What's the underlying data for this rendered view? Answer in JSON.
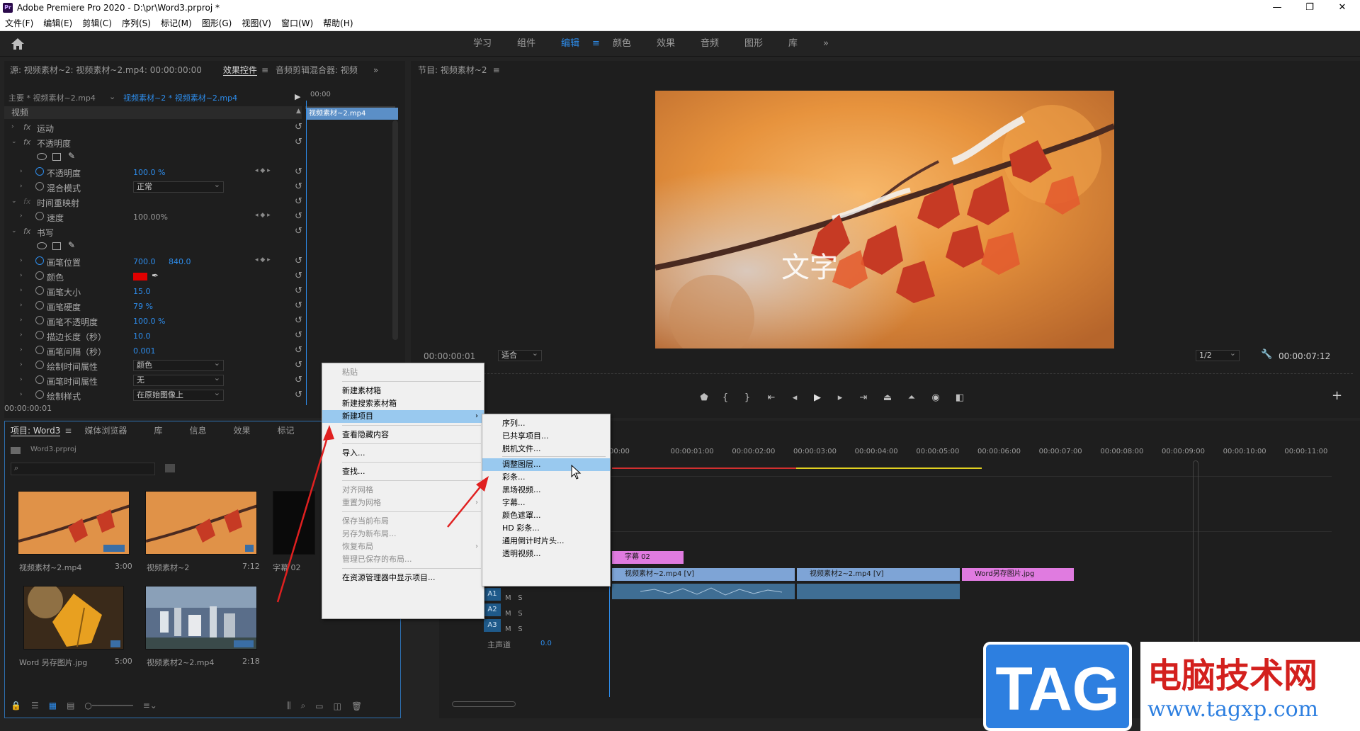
{
  "app": {
    "title": "Adobe Premiere Pro 2020 - D:\\pr\\Word3.prproj *",
    "badge": "Pr"
  },
  "window_controls": {
    "minimize": "—",
    "maximize": "❐",
    "close": "✕"
  },
  "menubar": [
    "文件(F)",
    "编辑(E)",
    "剪辑(C)",
    "序列(S)",
    "标记(M)",
    "图形(G)",
    "视图(V)",
    "窗口(W)",
    "帮助(H)"
  ],
  "workspaces": {
    "items": [
      "学习",
      "组件",
      "编辑",
      "颜色",
      "效果",
      "音频",
      "图形",
      "库"
    ],
    "active": "编辑",
    "more": "»"
  },
  "source_panel": {
    "tabs": [
      "源: 视频素材~2: 视频素材~2.mp4: 00:00:00:00",
      "效果控件",
      "音频剪辑混合器: 视频"
    ],
    "master": "主要 * 视频素材~2.mp4",
    "clip": "视频素材~2 * 视频素材~2.mp4",
    "time0": "00:00",
    "mini_clip": "视频素材~2.mp4",
    "section": "视频",
    "timecode": "00:00:00:01"
  },
  "effects": [
    {
      "type": "fx",
      "label": "运动"
    },
    {
      "type": "fx",
      "label": "不透明度",
      "open": true
    },
    {
      "type": "shapes"
    },
    {
      "type": "prop",
      "label": "不透明度",
      "value": "100.0 %",
      "kf": true
    },
    {
      "type": "select",
      "label": "混合模式",
      "value": "正常"
    },
    {
      "type": "fxg",
      "label": "时间重映射",
      "open": true
    },
    {
      "type": "prop",
      "label": "速度",
      "value": "100.00%",
      "kf": true,
      "gray": true
    },
    {
      "type": "fx",
      "label": "书写",
      "open": true
    },
    {
      "type": "shapes"
    },
    {
      "type": "prop",
      "label": "画笔位置",
      "value": "700.0",
      "value2": "840.0",
      "kf": true
    },
    {
      "type": "color",
      "label": "颜色"
    },
    {
      "type": "prop",
      "label": "画笔大小",
      "value": "15.0"
    },
    {
      "type": "prop",
      "label": "画笔硬度",
      "value": "79 %"
    },
    {
      "type": "prop",
      "label": "画笔不透明度",
      "value": "100.0 %"
    },
    {
      "type": "prop",
      "label": "描边长度（秒）",
      "value": "10.0"
    },
    {
      "type": "prop",
      "label": "画笔间隔（秒）",
      "value": "0.001"
    },
    {
      "type": "select",
      "label": "绘制时间属性",
      "value": "颜色"
    },
    {
      "type": "select",
      "label": "画笔时间属性",
      "value": "无"
    },
    {
      "type": "select",
      "label": "绘制样式",
      "value": "在原始图像上"
    }
  ],
  "program": {
    "title": "节目: 视频素材~2",
    "overlay_text": "文字",
    "timecode": "00:00:00:01",
    "fit": "适合",
    "resolution": "1/2",
    "duration": "00:00:07:12"
  },
  "project": {
    "tabs": [
      "项目: Word3",
      "媒体浏览器",
      "库",
      "信息",
      "效果",
      "标记"
    ],
    "file": "Word3.prproj",
    "items": [
      {
        "name": "视频素材~2.mp4",
        "dur": "3:00"
      },
      {
        "name": "视频素材~2",
        "dur": "7:12"
      },
      {
        "name": "字幕 02",
        "dur": ""
      },
      {
        "name": "Word 另存图片.jpg",
        "dur": "5:00"
      },
      {
        "name": "视频素材2~2.mp4",
        "dur": "2:18"
      }
    ]
  },
  "context_menu": {
    "items": [
      {
        "label": "粘贴",
        "dis": true
      },
      {
        "sep": true
      },
      {
        "label": "新建素材箱"
      },
      {
        "label": "新建搜索素材箱"
      },
      {
        "label": "新建项目",
        "hl": true,
        "sub": true
      },
      {
        "sep": true
      },
      {
        "label": "查看隐藏内容"
      },
      {
        "sep": true
      },
      {
        "label": "导入..."
      },
      {
        "sep": true
      },
      {
        "label": "查找..."
      },
      {
        "sep": true
      },
      {
        "label": "对齐网格",
        "dis": true
      },
      {
        "label": "重置为网格",
        "dis": true,
        "sub": true
      },
      {
        "sep": true
      },
      {
        "label": "保存当前布局",
        "dis": true
      },
      {
        "label": "另存为新布局...",
        "dis": true
      },
      {
        "label": "恢复布局",
        "dis": true,
        "sub": true
      },
      {
        "label": "管理已保存的布局...",
        "dis": true
      },
      {
        "sep": true
      },
      {
        "label": "在资源管理器中显示项目..."
      }
    ]
  },
  "submenu": {
    "items": [
      "序列...",
      "已共享项目...",
      "脱机文件...",
      "调整图层...",
      "彩条...",
      "黑场视频...",
      "字幕...",
      "颜色遮罩...",
      "HD 彩条...",
      "通用倒计时片头...",
      "透明视频..."
    ],
    "highlight": "调整图层..."
  },
  "timeline": {
    "ruler": [
      "00:00",
      "00:00:01:00",
      "00:00:02:00",
      "00:00:03:00",
      "00:00:04:00",
      "00:00:05:00",
      "00:00:06:00",
      "00:00:07:00",
      "00:00:08:00",
      "00:00:09:00",
      "00:00:10:00",
      "00:00:11:00"
    ],
    "clips": {
      "title": "字幕 02",
      "v1a": "视频素材~2.mp4 [V]",
      "v1b": "视频素材2~2.mp4 [V]",
      "v1c": "Word另存图片.jpg"
    },
    "audio_tracks": [
      "A1",
      "A2",
      "A3"
    ],
    "msv": [
      "M",
      "S"
    ],
    "master": "主声道",
    "master_val": "0.0"
  },
  "watermark": {
    "tag": "TAG",
    "cn": "电脑技术网",
    "url": "www.tagxp.com"
  }
}
